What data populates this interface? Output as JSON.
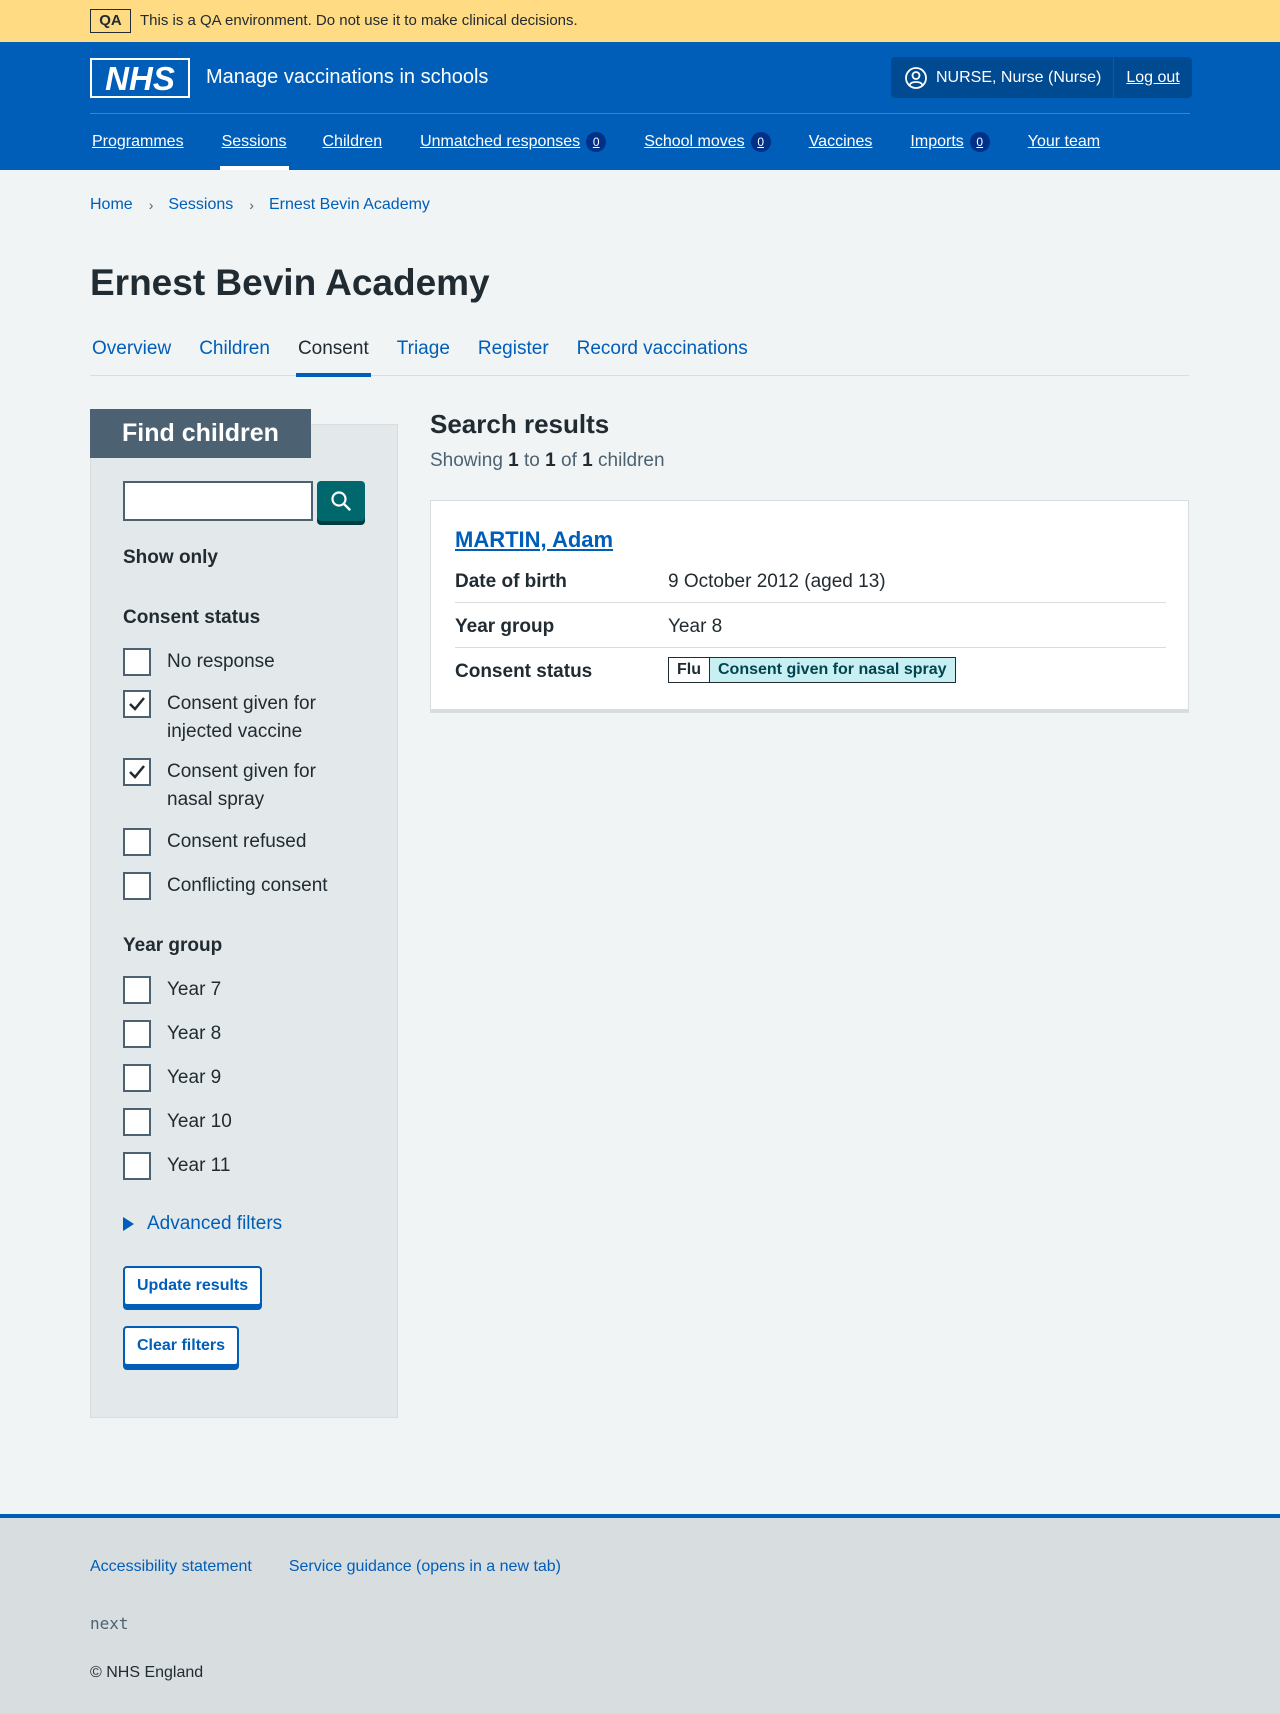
{
  "env_banner": {
    "tag": "QA",
    "text": "This is a QA environment. Do not use it to make clinical decisions."
  },
  "header": {
    "logo_text": "NHS",
    "service_name": "Manage vaccinations in schools",
    "user": "NURSE, Nurse (Nurse)",
    "logout": "Log out"
  },
  "nav": [
    {
      "label": "Programmes"
    },
    {
      "label": "Sessions",
      "active": true
    },
    {
      "label": "Children"
    },
    {
      "label": "Unmatched responses",
      "count": "0"
    },
    {
      "label": "School moves",
      "count": "0"
    },
    {
      "label": "Vaccines"
    },
    {
      "label": "Imports",
      "count": "0"
    },
    {
      "label": "Your team"
    }
  ],
  "breadcrumb": [
    "Home",
    "Sessions",
    "Ernest Bevin Academy"
  ],
  "page_title": "Ernest Bevin Academy",
  "subnav": [
    "Overview",
    "Children",
    "Consent",
    "Triage",
    "Register",
    "Record vaccinations"
  ],
  "subnav_active": "Consent",
  "filters": {
    "heading": "Find children",
    "search_value": "",
    "show_only": "Show only",
    "consent_status_label": "Consent status",
    "consent_options": [
      {
        "label": "No response",
        "checked": false
      },
      {
        "label": "Consent given for injected vaccine",
        "checked": true
      },
      {
        "label": "Consent given for nasal spray",
        "checked": true
      },
      {
        "label": "Consent refused",
        "checked": false
      },
      {
        "label": "Conflicting consent",
        "checked": false
      }
    ],
    "year_group_label": "Year group",
    "year_options": [
      {
        "label": "Year 7",
        "checked": false
      },
      {
        "label": "Year 8",
        "checked": false
      },
      {
        "label": "Year 9",
        "checked": false
      },
      {
        "label": "Year 10",
        "checked": false
      },
      {
        "label": "Year 11",
        "checked": false
      }
    ],
    "advanced": "Advanced filters",
    "update": "Update results",
    "clear": "Clear filters"
  },
  "results": {
    "title": "Search results",
    "showing": "Showing",
    "from": "1",
    "to_word": "to",
    "to": "1",
    "of_word": "of",
    "total": "1",
    "unit": "children",
    "child": {
      "name": "MARTIN, Adam",
      "dob_label": "Date of birth",
      "dob": "9 October 2012 (aged 13)",
      "year_label": "Year group",
      "year": "Year 8",
      "consent_label": "Consent status",
      "programme": "Flu",
      "consent": "Consent given for nasal spray"
    }
  },
  "footer": {
    "links": [
      "Accessibility statement",
      "Service guidance (opens in a new tab)"
    ],
    "version": "next",
    "copyright": "© NHS England"
  }
}
